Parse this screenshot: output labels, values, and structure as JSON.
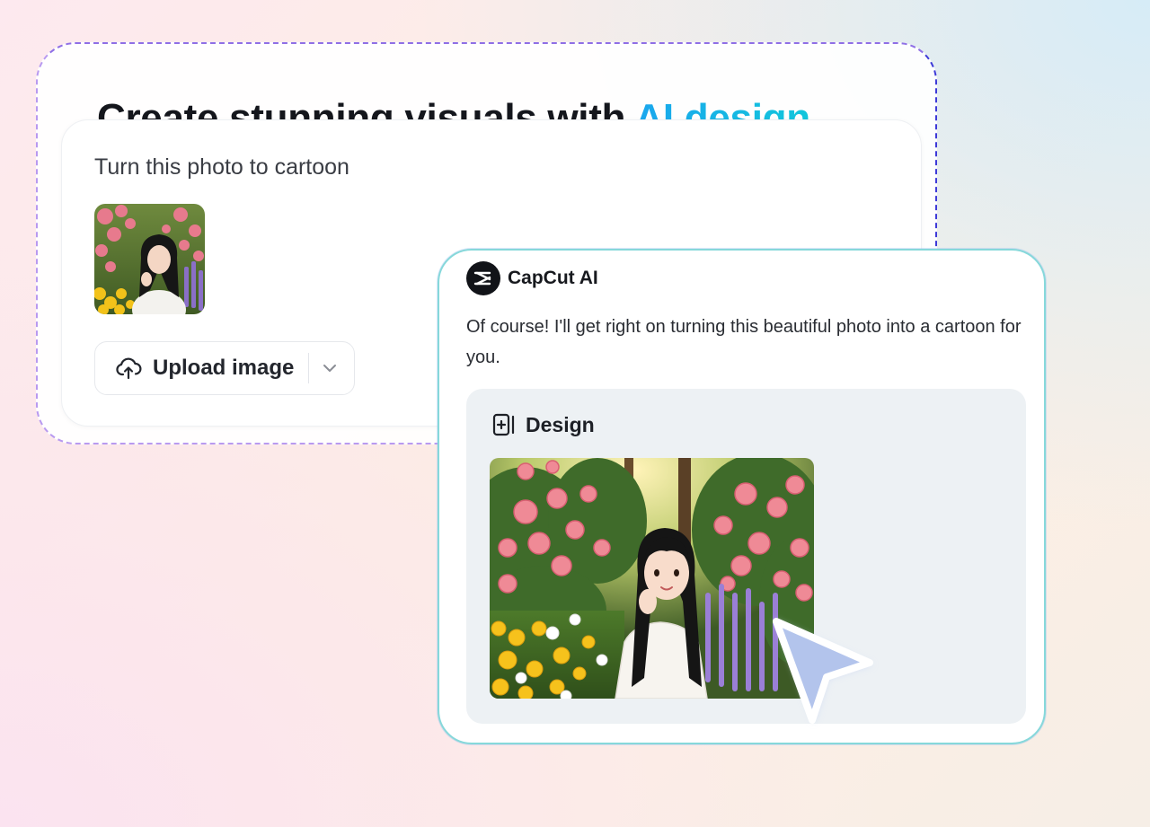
{
  "headline": {
    "text": "Create stunning visuals with ",
    "accent": "AI design"
  },
  "prompt": {
    "text": "Turn this photo to cartoon",
    "upload_label": "Upload image",
    "upload_icon": "cloud-upload-icon",
    "dropdown_icon": "chevron-down-icon"
  },
  "response": {
    "agent_name": "CapCut AI",
    "agent_logo": "capcut-logo-icon",
    "message": "Of course! I'll get right on turning this beautiful photo into a cartoon for you.",
    "design_label": "Design",
    "design_icon": "add-design-icon"
  },
  "colors": {
    "accent_start": "#1aa6ee",
    "accent_end": "#12c6db",
    "card_border": "#86d8da",
    "cursor_fill": "#b3c4ec"
  }
}
